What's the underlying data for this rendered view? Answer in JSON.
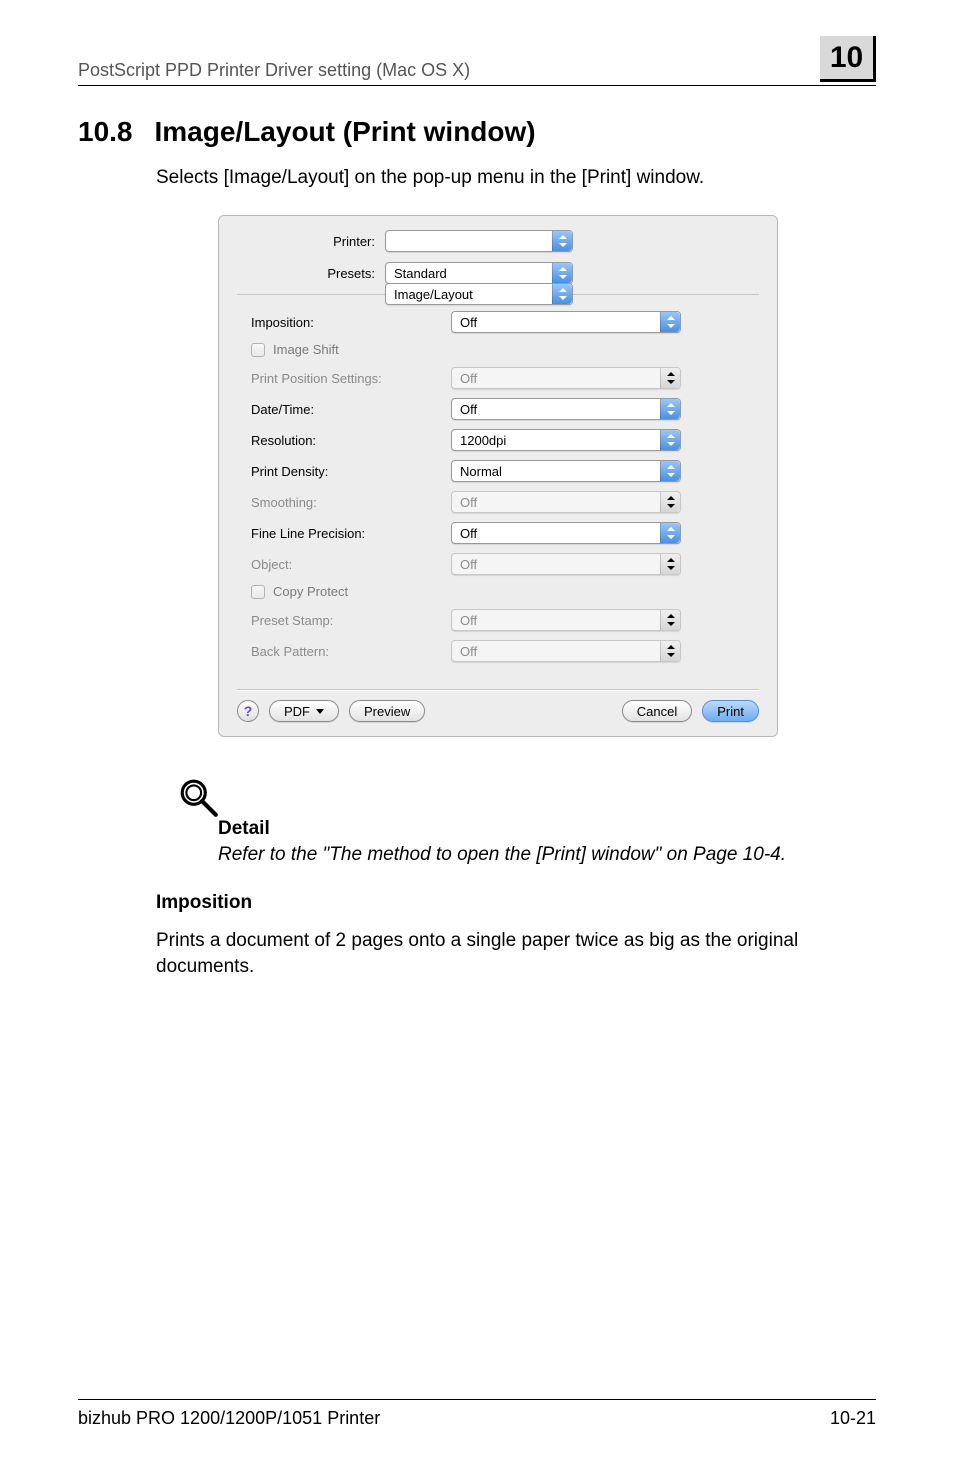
{
  "header": {
    "running": "PostScript PPD Printer Driver setting (Mac OS X)",
    "chapter": "10"
  },
  "section": {
    "number": "10.8",
    "title": "Image/Layout (Print window)"
  },
  "intro": "Selects [Image/Layout] on the pop-up menu in the [Print] window.",
  "dialog": {
    "printer_label": "Printer:",
    "printer_value": "",
    "presets_label": "Presets:",
    "presets_value": "Standard",
    "panel_value": "Image/Layout",
    "rows": {
      "imposition": {
        "label": "Imposition:",
        "value": "Off",
        "enabled": true
      },
      "image_shift": {
        "label": "Image Shift"
      },
      "print_pos": {
        "label": "Print Position Settings:",
        "value": "Off",
        "enabled": false
      },
      "date_time": {
        "label": "Date/Time:",
        "value": "Off",
        "enabled": true
      },
      "resolution": {
        "label": "Resolution:",
        "value": "1200dpi",
        "enabled": true
      },
      "density": {
        "label": "Print Density:",
        "value": "Normal",
        "enabled": true
      },
      "smoothing": {
        "label": "Smoothing:",
        "value": "Off",
        "enabled": false
      },
      "fine_line": {
        "label": "Fine Line Precision:",
        "value": "Off",
        "enabled": true
      },
      "object": {
        "label": "Object:",
        "value": "Off",
        "enabled": false
      },
      "copy_protect": {
        "label": "Copy Protect"
      },
      "preset_stamp": {
        "label": "Preset Stamp:",
        "value": "Off",
        "enabled": false
      },
      "back_pattern": {
        "label": "Back Pattern:",
        "value": "Off",
        "enabled": false
      }
    },
    "buttons": {
      "help": "?",
      "pdf": "PDF ▾",
      "preview": "Preview",
      "cancel": "Cancel",
      "print": "Print"
    }
  },
  "detail": {
    "heading": "Detail",
    "text": "Refer to the \"The method to open the [Print] window\" on Page 10-4."
  },
  "imposition_section": {
    "heading": "Imposition",
    "body": "Prints a document of 2 pages onto a single paper twice as big as the original documents."
  },
  "footer": {
    "left": "bizhub PRO 1200/1200P/1051 Printer",
    "right": "10-21"
  }
}
